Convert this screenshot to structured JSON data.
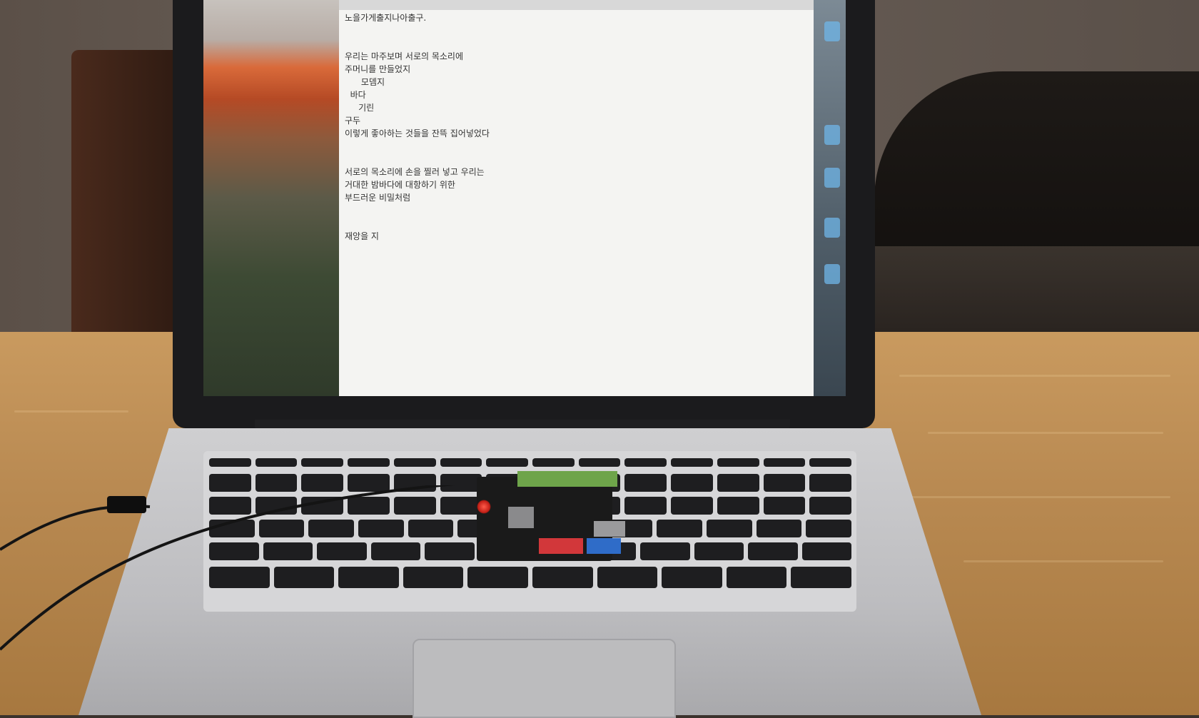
{
  "document": {
    "lines": [
      "노을가게출지나아출구.",
      "",
      "",
      "우리는 마주보며 서로의 목소리에",
      "주머니를 만들었지",
      "      모뎀지",
      "  바다",
      "     기린",
      "구두",
      "이렇게 좋아하는 것들을 잔뜩 집어넣었다",
      "",
      "",
      "서로의 목소리에 손을 찔러 넣고 우리는",
      "거대한 밤바다에 대항하기 위한",
      "부드러운 비밀처럼",
      "",
      "",
      "재앙을 지"
    ]
  },
  "colors": {
    "document_background": "#f4f4f2",
    "text": "#333333",
    "table": "#c99a5f",
    "board_led": "#e0322a"
  }
}
